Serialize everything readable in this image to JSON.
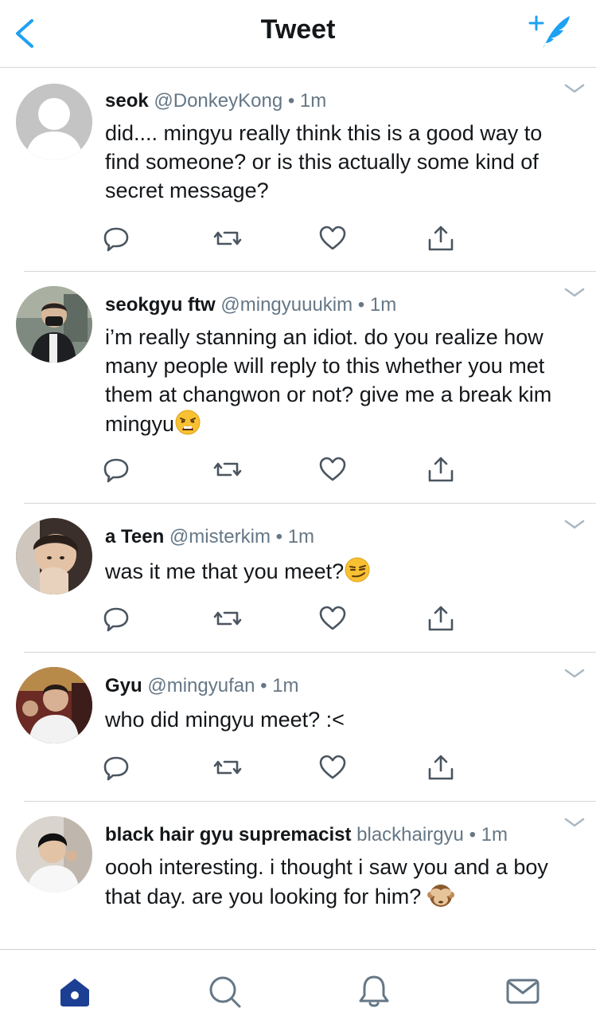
{
  "header": {
    "title": "Tweet"
  },
  "colors": {
    "accent": "#1da1f2",
    "tab_active": "#1c3f94",
    "icon_gray": "#657786",
    "divider": "#d6d6d6"
  },
  "tweets": [
    {
      "name": "seok",
      "handle": "@DonkeyKong",
      "dot": "•",
      "time": "1m",
      "text": "did.... mingyu really think this is a good way to find someone? or is this actually some kind of secret message?",
      "avatar": "default-avatar"
    },
    {
      "name": "seokgyu ftw",
      "handle": "@mingyuuukim",
      "dot": "•",
      "time": "1m",
      "text": "i’m really stanning an idiot. do you realize how many people will reply to this whether you met them at changwon or not? give me a break kim mingyu",
      "emoji": "weary-face",
      "avatar": "photo"
    },
    {
      "name": "a Teen",
      "handle": "@misterkim",
      "dot": "•",
      "time": "1m",
      "text": "was it me that you meet?",
      "emoji": "smirking-face",
      "avatar": "photo"
    },
    {
      "name": "Gyu",
      "handle": "@mingyufan",
      "dot": "•",
      "time": "1m",
      "text": "who did mingyu meet? :<",
      "avatar": "photo"
    },
    {
      "name": "black hair gyu supremacist",
      "handle": "blackhairgyu",
      "dot": "•",
      "time": "1m",
      "text": "oooh interesting. i thought i saw you and a boy that day. are you looking for him?",
      "emoji": "see-no-evil-monkey",
      "avatar": "photo"
    }
  ],
  "tabs": [
    "home",
    "search",
    "notifications",
    "messages"
  ]
}
